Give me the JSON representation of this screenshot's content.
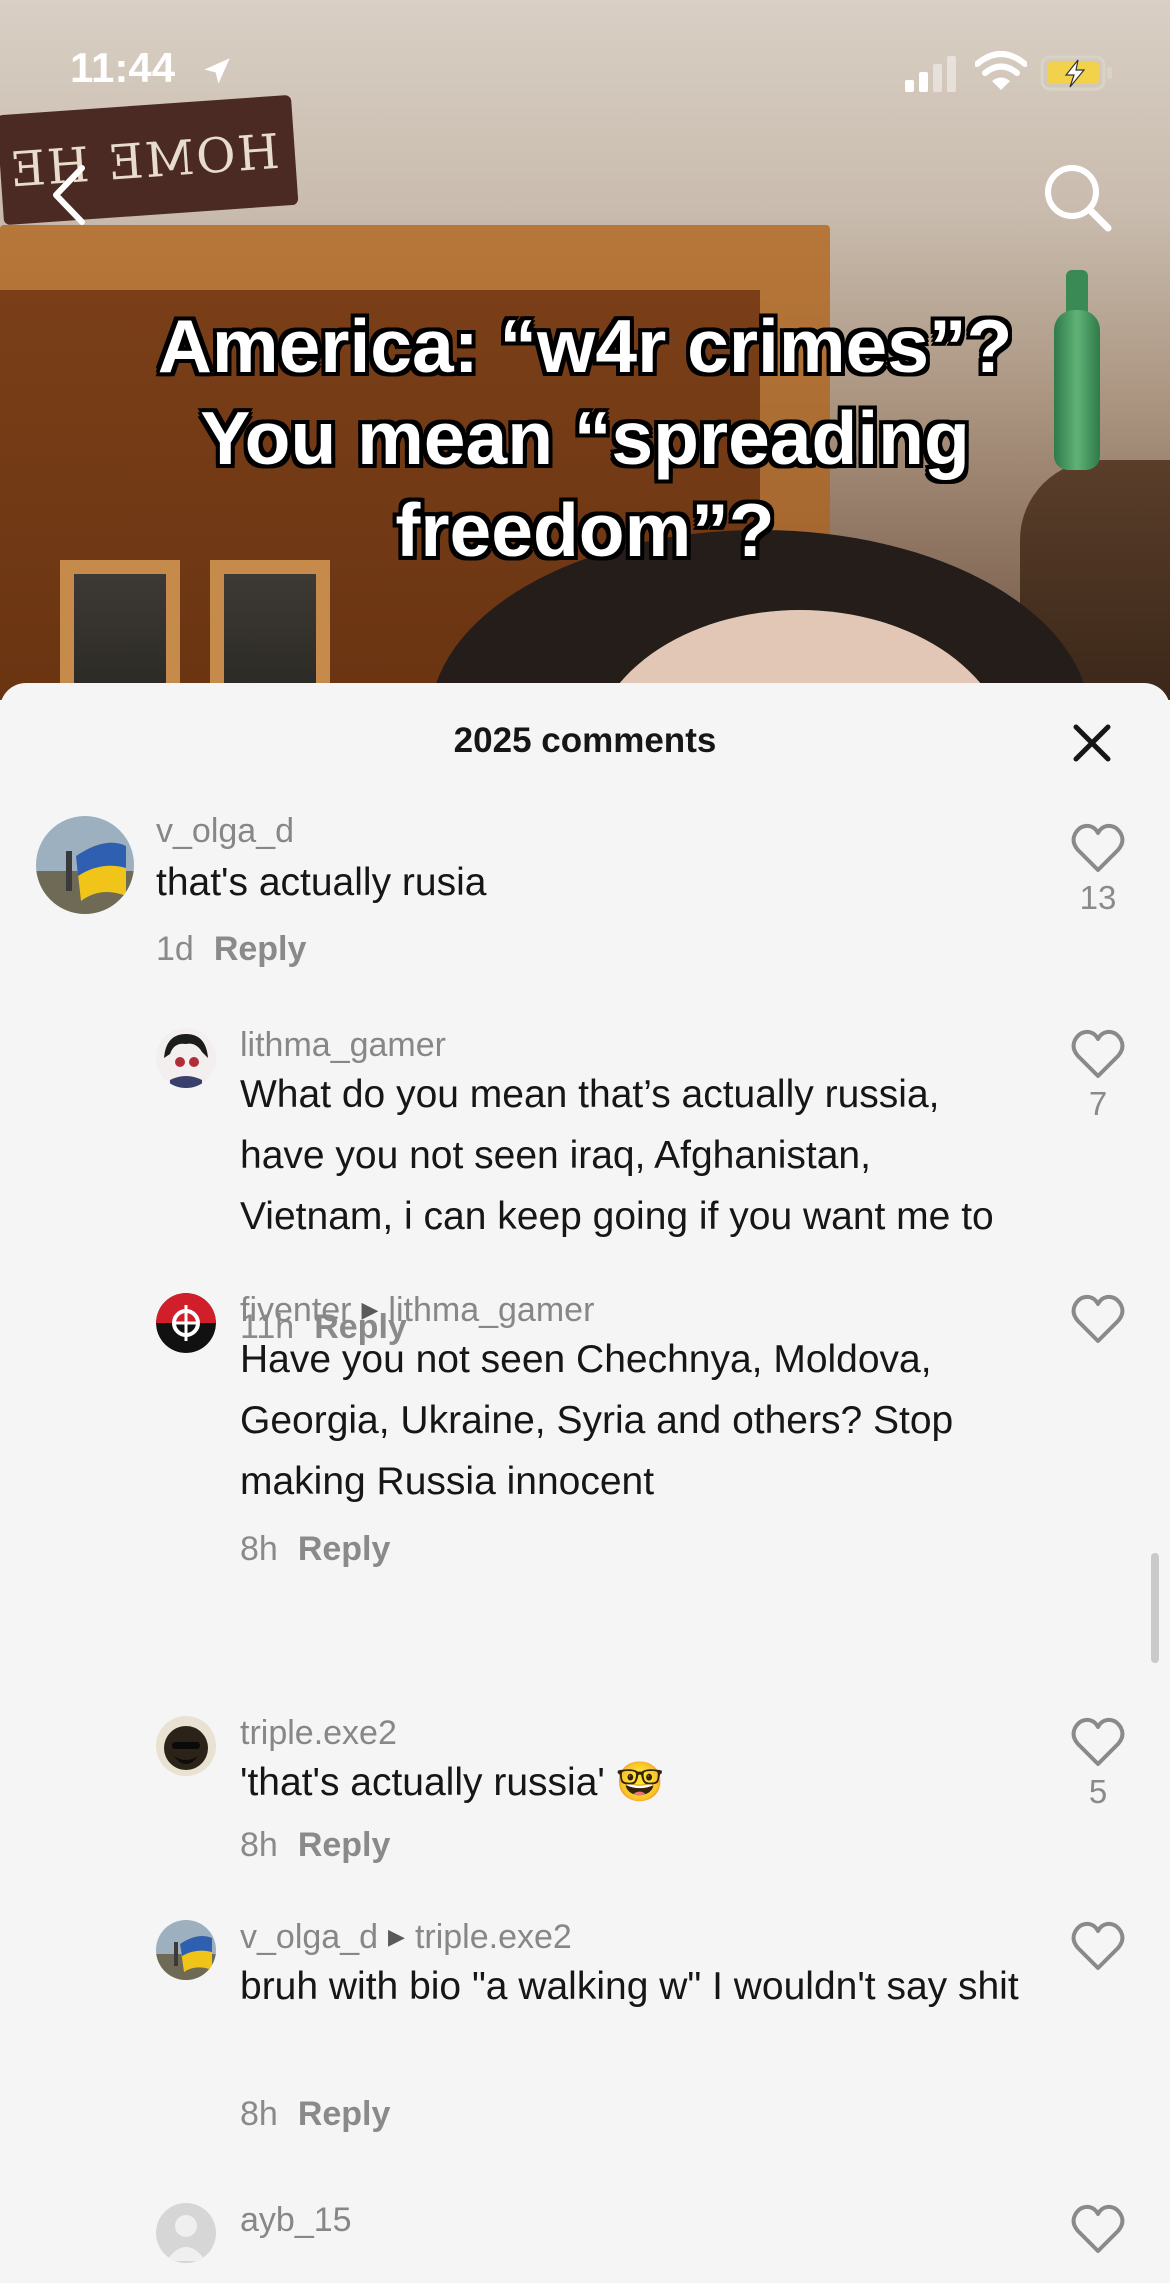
{
  "status_bar": {
    "time": "11:44"
  },
  "video": {
    "sign_text": "HOME HE",
    "caption_lines": [
      "America: “w4r crimes”?",
      "You mean “spreading",
      "freedom”?"
    ]
  },
  "comments_sheet": {
    "title": "2025 comments",
    "comments": [
      {
        "username": "v_olga_d",
        "text": "that's actually rusia",
        "time": "1d",
        "reply_label": "Reply",
        "likes": "13"
      },
      {
        "username": "lithma_gamer",
        "text": "What do you mean that’s actually russia, have you not seen iraq, Afghanistan, Vietnam, i can keep going if you want me to",
        "time": "11h",
        "reply_label": "Reply",
        "likes": "7"
      },
      {
        "username": "fiventer",
        "reply_to": "lithma_gamer",
        "text": "Have you not seen Chechnya, Moldova, Georgia, Ukraine, Syria and others? Stop making Russia innocent",
        "time": "8h",
        "reply_label": "Reply",
        "likes": ""
      },
      {
        "username": "triple.exe2",
        "text": "'that's actually russia' 🤓",
        "time": "8h",
        "reply_label": "Reply",
        "likes": "5"
      },
      {
        "username": "v_olga_d",
        "reply_to": "triple.exe2",
        "text": "bruh with bio \"a walking w\" I wouldn't say shit",
        "time": "8h",
        "reply_label": "Reply",
        "likes": ""
      },
      {
        "username": "ayb_15",
        "text": "",
        "time": "",
        "reply_label": "",
        "likes": ""
      }
    ]
  },
  "icons": {
    "back": "chevron-left-icon",
    "search": "search-icon",
    "close": "close-icon",
    "like": "heart-outline-icon",
    "location": "location-arrow-icon",
    "signal": "cellular-signal-icon",
    "wifi": "wifi-icon",
    "battery": "battery-charging-icon"
  },
  "colors": {
    "sheet_background": "#f5f5f5",
    "battery": "#f2d14b",
    "text_primary": "#161616",
    "text_secondary": "#8a8a8a"
  }
}
